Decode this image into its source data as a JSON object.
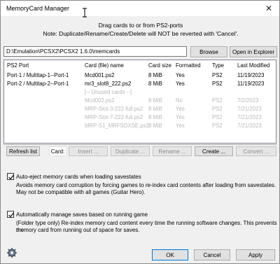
{
  "window": {
    "title": "MemoryCard Manager",
    "close_glyph": "✕"
  },
  "instructions": {
    "line1": "Drag cards to or from PS2-ports",
    "line2": "Note: Duplicate/Rename/Create/Delete will NOT be reverted with 'Cancel'."
  },
  "path": {
    "value": "D:\\Emulation\\PCSX2\\PCSX2 1.6.0\\memcards",
    "browse_label": "Browse",
    "open_explorer_label": "Open in Explorer"
  },
  "table": {
    "headers": [
      "PS2 Port",
      "Card (file) name",
      "Card size",
      "Formatted",
      "Type",
      "Last Modified"
    ],
    "rows": [
      {
        "port": "Port-1 / Multitap-1--Port-1",
        "name": "Mcd001.ps2",
        "size": "8 MiB",
        "formatted": "Yes",
        "type": "PS2",
        "modified": "11/19/2023",
        "dim": false
      },
      {
        "port": "Port-2 / Multitap-2--Port-1",
        "name": "mr3_slot8_222.ps2",
        "size": "8 MiB",
        "formatted": "Yes",
        "type": "PS2",
        "modified": "11/19/2023",
        "dim": false
      },
      {
        "port": "",
        "name": "[-- Unused cards --]",
        "size": "",
        "formatted": "",
        "type": "",
        "modified": "",
        "dim": true
      },
      {
        "port": "",
        "name": "Mcd002.ps2",
        "size": "8 MiB",
        "formatted": "No",
        "type": "PS2",
        "modified": "7/2/2023",
        "dim": true
      },
      {
        "port": "",
        "name": "MRP-Slot-3-222-full.ps2",
        "size": "8 MiB",
        "formatted": "Yes",
        "type": "PS2",
        "modified": "7/21/2023",
        "dim": true
      },
      {
        "port": "",
        "name": "MRP-Slot-7-222-full.ps2",
        "size": "8 MiB",
        "formatted": "Yes",
        "type": "PS2",
        "modified": "7/21/2023",
        "dim": true
      },
      {
        "port": "",
        "name": "MRP-S1_MRFSDXSE.ps2",
        "size": "8 MiB",
        "formatted": "Yes",
        "type": "PS2",
        "modified": "7/21/2023",
        "dim": true
      }
    ]
  },
  "actions": {
    "refresh_label": "Refresh list",
    "card_label": "Card:",
    "insert_label": "Insert ...",
    "duplicate_label": "Duplicate ...",
    "rename_label": "Rename ...",
    "create_label": "Create ...",
    "convert_label": "Convert ..."
  },
  "options": {
    "auto_eject": {
      "checked": true,
      "label": "Auto-eject memory cards when loading savestates",
      "desc1": "Avoids memory card corruption by forcing games to re-index card contents after loading from savestates.",
      "desc2": "May not be compatible with all games (Guitar Hero)."
    },
    "auto_manage": {
      "checked": true,
      "label": "Automatically manage saves based on running game",
      "desc1": "(Folder type only) Re-index memory card content every time the running software changes. This prevents the",
      "desc2": "memory card from running out of space for saves."
    }
  },
  "footer": {
    "settings_icon": "gear-icon",
    "ok_label": "OK",
    "cancel_label": "Cancel",
    "apply_label": "Apply"
  }
}
